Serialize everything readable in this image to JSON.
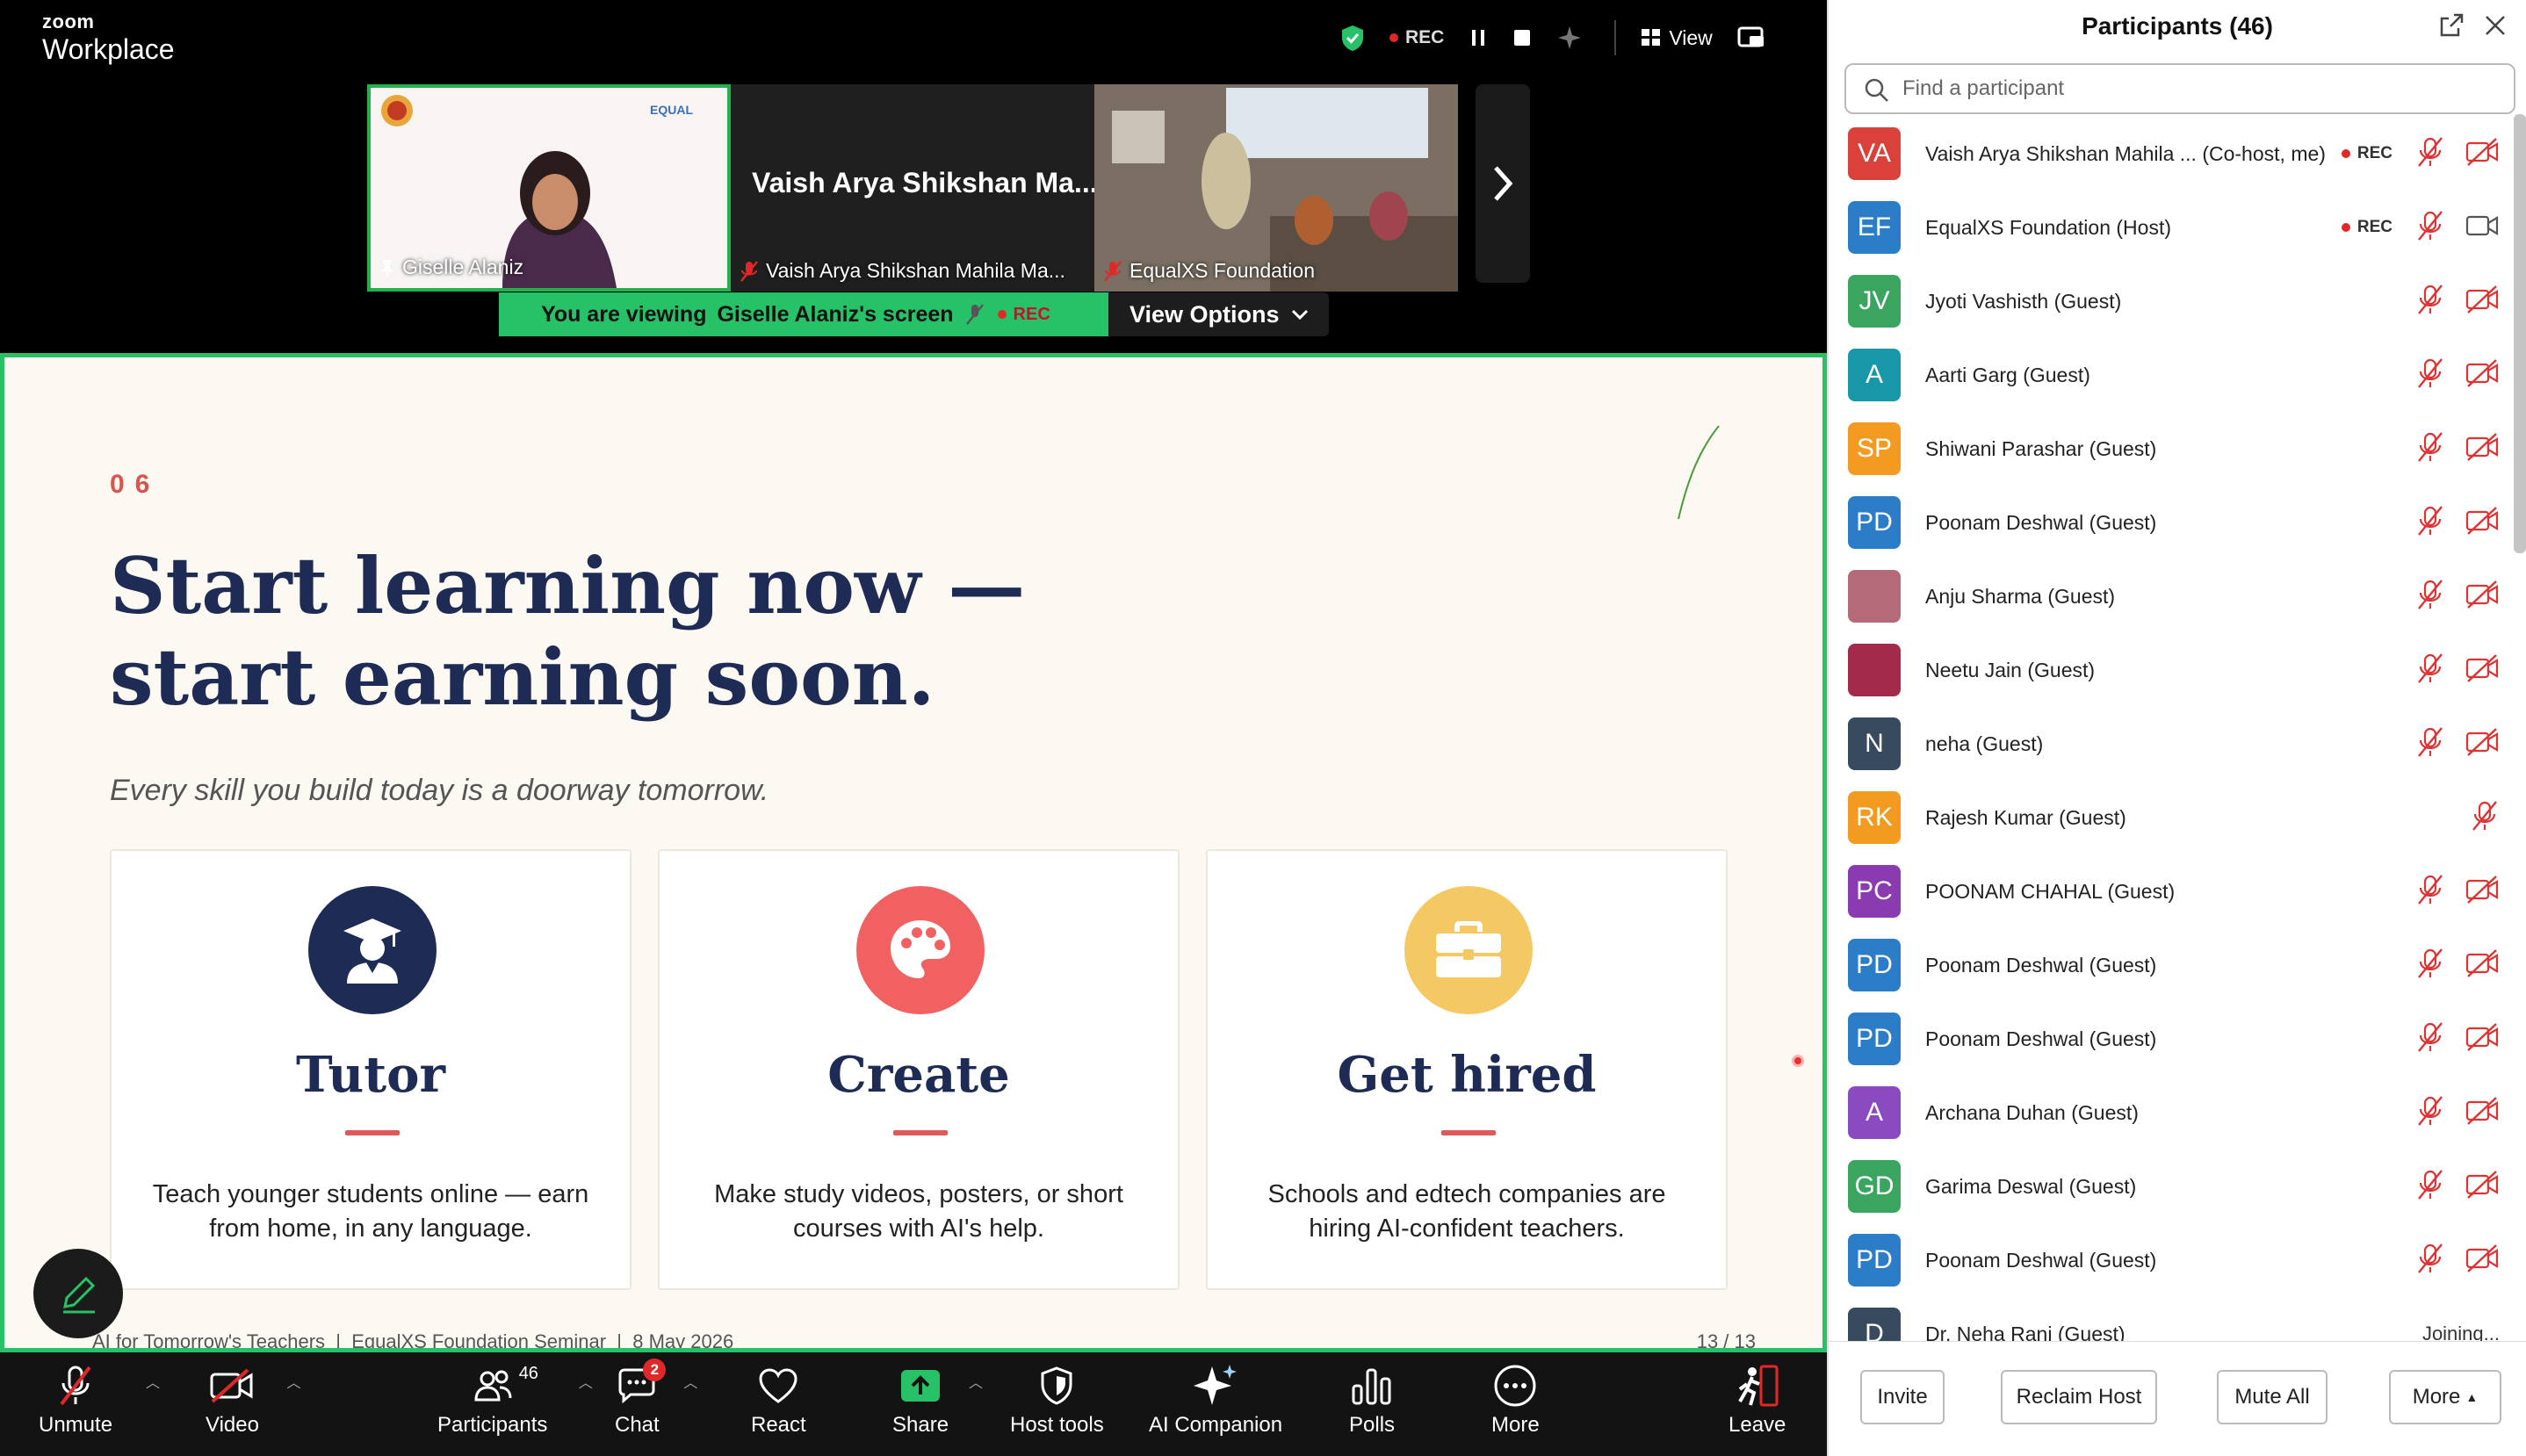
{
  "app": {
    "brand_small": "zoom",
    "brand_big": "Workplace"
  },
  "topbar": {
    "rec_label": "REC",
    "view_label": "View"
  },
  "thumbnails": [
    {
      "name": "Giselle Alaniz",
      "big_name": ""
    },
    {
      "name": "Vaish Arya Shikshan Mahila Ma...",
      "big_name": "Vaish Arya Shikshan Ma..."
    },
    {
      "name": "EqualXS Foundation",
      "big_name": ""
    }
  ],
  "viewing": {
    "prefix": "You are viewing",
    "screen": "Giselle Alaniz's screen",
    "rec": "REC",
    "view_options": "View Options"
  },
  "slide": {
    "number": "06",
    "title_line1": "Start learning now —",
    "title_line2": "start earning soon.",
    "subtitle": "Every skill you build today is a doorway tomorrow.",
    "cards": [
      {
        "title": "Tutor",
        "desc": "Teach younger students online — earn from home, in any language.",
        "color": "#1e2b55",
        "icon": "graduate-icon"
      },
      {
        "title": "Create",
        "desc": "Make study videos, posters, or short courses with AI's help.",
        "color": "#f16161",
        "icon": "palette-icon"
      },
      {
        "title": "Get hired",
        "desc": "Schools and edtech companies are hiring AI-confident teachers.",
        "color": "#f4c863",
        "icon": "briefcase-icon"
      }
    ],
    "footer": "AI for Tomorrow's Teachers  |  EqualXS Foundation Seminar  |  8 May 2026",
    "page": "13 / 13"
  },
  "toolbar": {
    "unmute": "Unmute",
    "video": "Video",
    "participants": "Participants",
    "participants_count": "46",
    "chat": "Chat",
    "chat_badge": "2",
    "react": "React",
    "share": "Share",
    "host_tools": "Host tools",
    "ai_companion": "AI Companion",
    "polls": "Polls",
    "more": "More",
    "leave": "Leave"
  },
  "panel": {
    "title": "Participants (46)",
    "search_placeholder": "Find a participant",
    "participants": [
      {
        "initials": "VA",
        "name": "Vaish Arya Shikshan Mahila ... (Co-host, me)",
        "color": "#d9413a",
        "rec": "REC",
        "video": "off"
      },
      {
        "initials": "EF",
        "name": "EqualXS Foundation (Host)",
        "color": "#2b7dc8",
        "rec": "REC",
        "video": "on"
      },
      {
        "initials": "JV",
        "name": "Jyoti Vashisth (Guest)",
        "color": "#3aa55f",
        "rec": "",
        "video": "off"
      },
      {
        "initials": "A",
        "name": "Aarti Garg (Guest)",
        "color": "#1797a8",
        "rec": "",
        "video": "off"
      },
      {
        "initials": "SP",
        "name": "Shiwani Parashar (Guest)",
        "color": "#f39a21",
        "rec": "",
        "video": "off"
      },
      {
        "initials": "PD",
        "name": "Poonam Deshwal (Guest)",
        "color": "#2b7dc8",
        "rec": "",
        "video": "off"
      },
      {
        "initials": "",
        "name": "Anju Sharma (Guest)",
        "color": "#b56a7a",
        "rec": "",
        "video": "off"
      },
      {
        "initials": "",
        "name": "Neetu Jain (Guest)",
        "color": "#a32a4a",
        "rec": "",
        "video": "off"
      },
      {
        "initials": "N",
        "name": "neha (Guest)",
        "color": "#384a5e",
        "rec": "",
        "video": "off"
      },
      {
        "initials": "RK",
        "name": "Rajesh Kumar (Guest)",
        "color": "#f39a21",
        "rec": "",
        "video": "none"
      },
      {
        "initials": "PC",
        "name": "POONAM CHAHAL (Guest)",
        "color": "#8a3bb0",
        "rec": "",
        "video": "off"
      },
      {
        "initials": "PD",
        "name": "Poonam Deshwal (Guest)",
        "color": "#2b7dc8",
        "rec": "",
        "video": "off"
      },
      {
        "initials": "PD",
        "name": "Poonam Deshwal (Guest)",
        "color": "#2b7dc8",
        "rec": "",
        "video": "off"
      },
      {
        "initials": "A",
        "name": "Archana Duhan (Guest)",
        "color": "#8a4bc0",
        "rec": "",
        "video": "off"
      },
      {
        "initials": "GD",
        "name": "Garima Deswal (Guest)",
        "color": "#3aa55f",
        "rec": "",
        "video": "off"
      },
      {
        "initials": "PD",
        "name": "Poonam Deshwal (Guest)",
        "color": "#2b7dc8",
        "rec": "",
        "video": "off"
      },
      {
        "initials": "D",
        "name": "Dr. Neha Rani (Guest)",
        "color": "#384a5e",
        "rec": "",
        "video": "joining",
        "status": "Joining..."
      }
    ],
    "buttons": {
      "invite": "Invite",
      "reclaim": "Reclaim Host",
      "mute_all": "Mute All",
      "more": "More"
    }
  }
}
